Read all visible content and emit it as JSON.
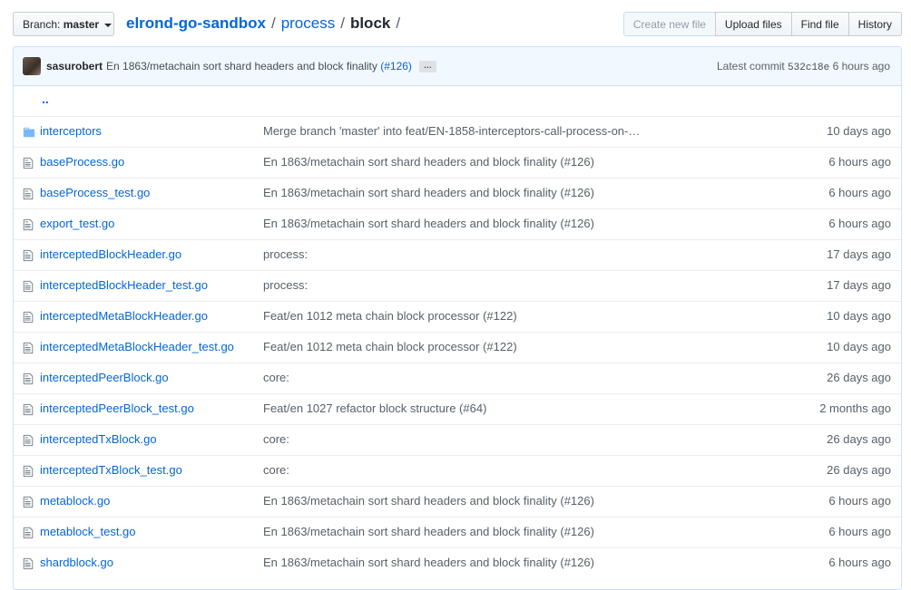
{
  "branch": {
    "label": "Branch:",
    "value": "master"
  },
  "breadcrumb": {
    "repo": "elrond-go-sandbox",
    "segment": "process",
    "current": "block",
    "sep": "/"
  },
  "actions": [
    "Create new file",
    "Upload files",
    "Find file",
    "History"
  ],
  "commit": {
    "author": "sasurobert",
    "message": "En 1863/metachain sort shard headers and block finality",
    "pr": "(#126)",
    "ellipsis": "…",
    "latest_label": "Latest commit",
    "sha": "532c18e",
    "age": "6 hours ago"
  },
  "parent_dir": "..",
  "files": [
    {
      "type": "dir",
      "name": "interceptors",
      "message": "Merge branch 'master' into feat/EN-1858-interceptors-call-process-on-…",
      "age": "10 days ago"
    },
    {
      "type": "file",
      "name": "baseProcess.go",
      "message": "En 1863/metachain sort shard headers and block finality (#126)",
      "age": "6 hours ago"
    },
    {
      "type": "file",
      "name": "baseProcess_test.go",
      "message": "En 1863/metachain sort shard headers and block finality (#126)",
      "age": "6 hours ago"
    },
    {
      "type": "file",
      "name": "export_test.go",
      "message": "En 1863/metachain sort shard headers and block finality (#126)",
      "age": "6 hours ago"
    },
    {
      "type": "file",
      "name": "interceptedBlockHeader.go",
      "message": "process:",
      "age": "17 days ago"
    },
    {
      "type": "file",
      "name": "interceptedBlockHeader_test.go",
      "message": "process:",
      "age": "17 days ago"
    },
    {
      "type": "file",
      "name": "interceptedMetaBlockHeader.go",
      "message": "Feat/en 1012 meta chain block processor (#122)",
      "age": "10 days ago"
    },
    {
      "type": "file",
      "name": "interceptedMetaBlockHeader_test.go",
      "message": "Feat/en 1012 meta chain block processor (#122)",
      "age": "10 days ago"
    },
    {
      "type": "file",
      "name": "interceptedPeerBlock.go",
      "message": "core:",
      "age": "26 days ago"
    },
    {
      "type": "file",
      "name": "interceptedPeerBlock_test.go",
      "message": "Feat/en 1027 refactor block structure (#64)",
      "age": "2 months ago"
    },
    {
      "type": "file",
      "name": "interceptedTxBlock.go",
      "message": "core:",
      "age": "26 days ago"
    },
    {
      "type": "file",
      "name": "interceptedTxBlock_test.go",
      "message": "core:",
      "age": "26 days ago"
    },
    {
      "type": "file",
      "name": "metablock.go",
      "message": "En 1863/metachain sort shard headers and block finality (#126)",
      "age": "6 hours ago"
    },
    {
      "type": "file",
      "name": "metablock_test.go",
      "message": "En 1863/metachain sort shard headers and block finality (#126)",
      "age": "6 hours ago"
    },
    {
      "type": "file",
      "name": "shardblock.go",
      "message": "En 1863/metachain sort shard headers and block finality (#126)",
      "age": "6 hours ago"
    }
  ]
}
